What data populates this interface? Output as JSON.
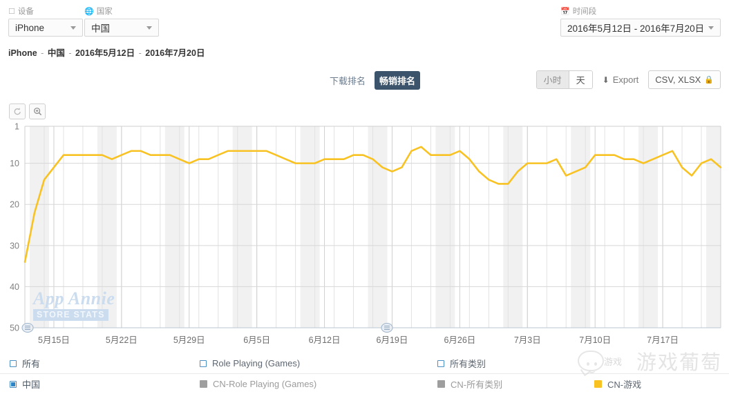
{
  "filters": {
    "device": {
      "label": "设备",
      "icon": "device-icon",
      "value": "iPhone"
    },
    "country": {
      "label": "国家",
      "icon": "globe-icon",
      "value": "中国"
    },
    "period": {
      "label": "时间段",
      "icon": "calendar-icon",
      "value": "2016年5月12日 - 2016年7月20日"
    }
  },
  "breadcrumb": {
    "device": "iPhone",
    "country": "中国",
    "date_start": "2016年5月12日",
    "date_end": "2016年7月20日",
    "separator": "-"
  },
  "tabs": [
    {
      "label": "下载排名",
      "active": false
    },
    {
      "label": "畅销排名",
      "active": true
    }
  ],
  "toolbar": {
    "granularity": [
      {
        "label": "小时",
        "active": false
      },
      {
        "label": "天",
        "active": true
      }
    ],
    "export_label": "Export",
    "export_icon": "download-icon",
    "formats_label": "CSV, XLSX",
    "lock_icon": "lock-icon"
  },
  "chart_controls": [
    {
      "name": "reset-zoom-button",
      "icon": "undo-icon"
    },
    {
      "name": "zoom-button",
      "icon": "magnifier-plus-icon"
    }
  ],
  "watermarks": {
    "app_annie_line1": "App Annie",
    "app_annie_line2": "STORE STATS",
    "publisher": "游戏葡萄",
    "publisher_small": "游戏"
  },
  "legend": {
    "rows": [
      [
        {
          "name": "legend-all",
          "type": "checkbox",
          "checked": false,
          "label": "所有",
          "style": "dark"
        },
        {
          "name": "legend-role-playing-games",
          "type": "checkbox",
          "checked": false,
          "label": "Role Playing (Games)",
          "style": "mid"
        },
        {
          "name": "legend-all-categories",
          "type": "checkbox",
          "checked": false,
          "label": "所有类别",
          "style": "mid"
        }
      ],
      [
        {
          "name": "legend-china",
          "type": "checkbox",
          "checked": true,
          "label": "中国",
          "style": "dark"
        },
        {
          "name": "legend-cn-role-playing-games",
          "type": "swatch",
          "color": "#9e9e9e",
          "label": "CN-Role Playing (Games)",
          "style": "gray"
        },
        {
          "name": "legend-cn-all-categories",
          "type": "swatch",
          "color": "#9e9e9e",
          "label": "CN-所有类别",
          "style": "gray"
        },
        {
          "name": "legend-cn-games",
          "type": "swatch",
          "color": "#f8c223",
          "label": "CN-游戏",
          "style": "mid"
        }
      ]
    ]
  },
  "chart_data": {
    "type": "line",
    "title": "",
    "xlabel": "",
    "ylabel": "",
    "y_inverted": true,
    "ylim": [
      1,
      50
    ],
    "yticks": [
      1,
      10,
      20,
      30,
      40,
      50
    ],
    "grid": true,
    "legend_position": "bottom",
    "line_color": "#f8c223",
    "x_start": "2016年5月12日",
    "x_end": "2016年7月20日",
    "xticks": [
      "5月15日",
      "5月22日",
      "5月29日",
      "6月5日",
      "6月12日",
      "6月19日",
      "6月26日",
      "7月3日",
      "7月10日",
      "7月17日"
    ],
    "xtick_indices": [
      3,
      10,
      17,
      24,
      31,
      38,
      45,
      52,
      59,
      66
    ],
    "series": [
      {
        "name": "CN-游戏",
        "color": "#f8c223",
        "values": [
          34,
          22,
          14,
          11,
          8,
          8,
          8,
          8,
          8,
          9,
          8,
          7,
          7,
          8,
          8,
          8,
          9,
          10,
          9,
          9,
          8,
          7,
          7,
          7,
          7,
          7,
          8,
          9,
          10,
          10,
          10,
          9,
          9,
          9,
          8,
          8,
          9,
          11,
          12,
          11,
          7,
          6,
          8,
          8,
          8,
          7,
          9,
          12,
          14,
          15,
          15,
          12,
          10,
          10,
          10,
          9,
          13,
          12,
          11,
          8,
          8,
          8,
          9,
          9,
          10,
          9,
          8,
          7,
          11,
          13,
          10,
          9,
          11
        ]
      }
    ]
  }
}
